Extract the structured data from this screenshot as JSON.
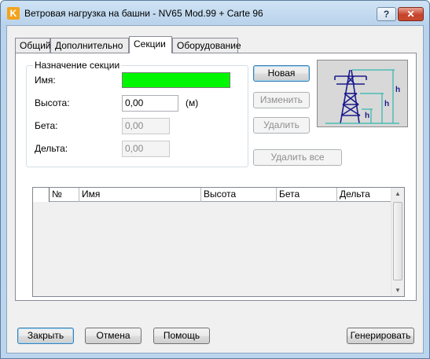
{
  "window": {
    "title": "Ветровая нагрузка на башни - NV65 Mod.99 + Carte 96",
    "app_icon": "K",
    "help_label": "?",
    "close_label": "✕"
  },
  "tabs": [
    "Общий",
    "Дополнительно",
    "Секции",
    "Оборудование"
  ],
  "section_group": {
    "legend": "Назначение секции",
    "name_label": "Имя:",
    "name_value": "",
    "height_label": "Высота:",
    "height_value": "0,00",
    "height_unit": "(м)",
    "beta_label": "Бета:",
    "beta_value": "0,00",
    "delta_label": "Дельта:",
    "delta_value": "0,00"
  },
  "section_buttons": {
    "new": "Новая",
    "modify": "Изменить",
    "delete": "Удалить",
    "delete_all": "Удалить все"
  },
  "preview": {
    "icon": "tower-diagram",
    "h_label": "h"
  },
  "grid": {
    "columns": [
      "№",
      "Имя",
      "Высота",
      "Бета",
      "Дельта"
    ],
    "rows": []
  },
  "footer": {
    "close": "Закрыть",
    "cancel": "Отмена",
    "help": "Помощь",
    "generate": "Генерировать"
  },
  "colors": {
    "name_field": "#00f700",
    "diagram_tower": "#1a1a8c",
    "diagram_dimension": "#2fb7ad"
  }
}
